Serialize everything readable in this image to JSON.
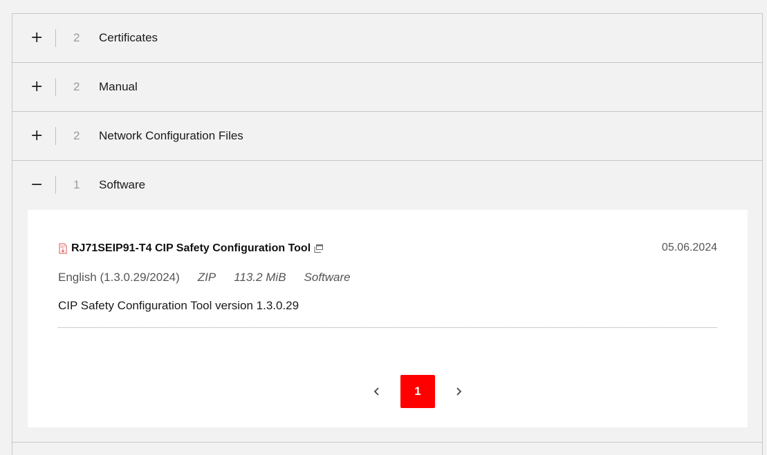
{
  "accordion": {
    "sections": [
      {
        "toggle": "+",
        "count": "2",
        "title": "Certificates"
      },
      {
        "toggle": "+",
        "count": "2",
        "title": "Manual"
      },
      {
        "toggle": "+",
        "count": "2",
        "title": "Network Configuration Files"
      },
      {
        "toggle": "−",
        "count": "1",
        "title": "Software"
      }
    ]
  },
  "software": {
    "document": {
      "icon": "zip-file-icon",
      "title": "RJ71SEIP91-T4 CIP Safety Configuration Tool",
      "external_icon": "open-in-new-window-icon",
      "date": "05.06.2024",
      "language": "English (1.3.0.29/2024)",
      "format": "ZIP",
      "size": "113.2 MiB",
      "category": "Software",
      "description": "CIP Safety Configuration Tool version 1.3.0.29"
    },
    "pagination": {
      "prev_icon": "chevron-left-icon",
      "current_page": "1",
      "next_icon": "chevron-right-icon"
    }
  },
  "colors": {
    "accent": "#ff0000",
    "background": "#f2f2f2",
    "panel": "#ffffff",
    "border": "#c8c8c8"
  }
}
